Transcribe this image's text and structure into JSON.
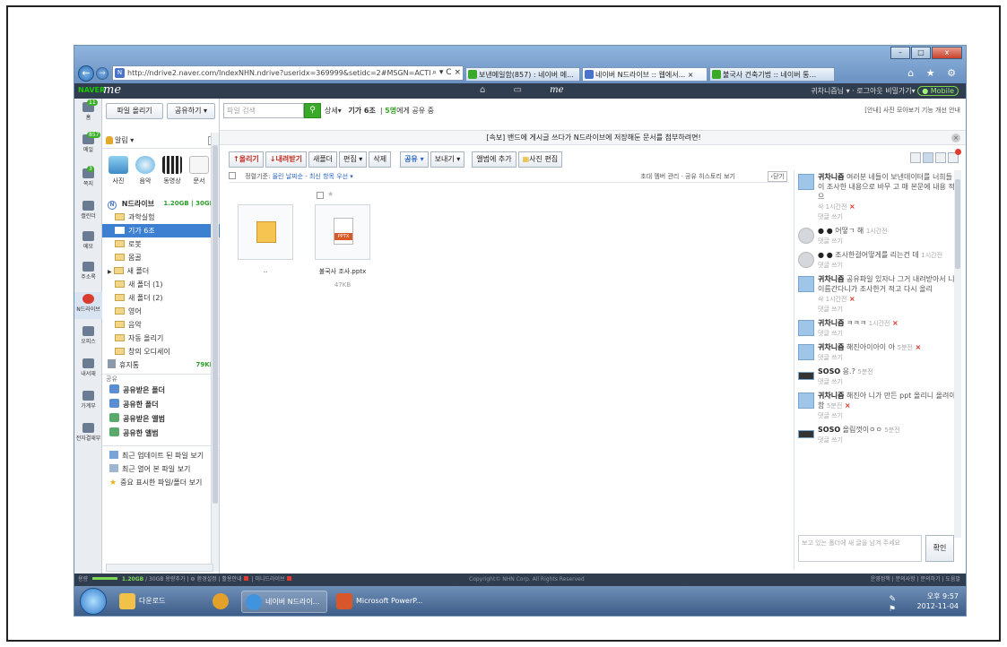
{
  "browser": {
    "url": "http://ndrive2.naver.com/IndexNHN.ndrive?useridx=369999&setidc=2#MSGN=ACTI",
    "url_controls": "⌕ ▾ C ×",
    "tabs": [
      {
        "label": "보낸메일함(857) : 네이버 메...",
        "color": "#3aa828"
      },
      {
        "label": "네이버 N드라이브 :: 웹에서... ×",
        "color": "#4a74c9"
      },
      {
        "label": "불국사 건축기법 :: 네이버 통...",
        "color": "#3aa828"
      }
    ],
    "win_controls": [
      "–",
      "□",
      "x"
    ],
    "right_icons": "⌂ ★ ⚙"
  },
  "naver_bar": {
    "logo": "NAVER",
    "me": "me",
    "center_icons": "⌂ ▭",
    "center_me": "me",
    "right_text": "귀차니즘님 ▾ · 로그아웃 비밀가기▾",
    "mobile": "Mobile"
  },
  "rail": [
    {
      "label": "홈",
      "badge": "11"
    },
    {
      "label": "메일",
      "badge": "857"
    },
    {
      "label": "쪽지",
      "badge": "3"
    },
    {
      "label": "캘린더",
      "badge": ""
    },
    {
      "label": "메모",
      "badge": ""
    },
    {
      "label": "주소록",
      "badge": ""
    },
    {
      "label": "N드라이브",
      "badge": ""
    },
    {
      "label": "오피스",
      "badge": ""
    },
    {
      "label": "내서재",
      "badge": ""
    },
    {
      "label": "가계부",
      "badge": ""
    },
    {
      "label": "전자결재부",
      "badge": ""
    }
  ],
  "sidebar": {
    "upload": "파일 올리기",
    "share": "공유하기 ▾",
    "alarm": "알림 ▾",
    "media": [
      "사진",
      "음악",
      "동영상",
      "문서"
    ],
    "drive_title": "N드라이브",
    "drive_size": "1.20GB | 30GB",
    "folders": [
      "과학실험",
      "기가 6조",
      "로봇",
      "몸골",
      "새 폴더",
      "새 폴더 (1)",
      "새 폴더 (2)",
      "영어",
      "음악",
      "자동 올리기",
      "창의 오디세이"
    ],
    "trash": "휴지통",
    "trash_size": "79KB",
    "share_header": "공유",
    "shared": [
      "공유받은 폴더",
      "공유한 폴더",
      "공유받은 앨범",
      "공유한 앨범"
    ],
    "extras": [
      "최근 업데이트 된 파일 보기",
      "최근 열어 본 파일 보기",
      "중요 표시한 파일/폴더 보기"
    ]
  },
  "main": {
    "search_placeholder": "파일 검색",
    "search_detail": "상세▾",
    "folder_title": "기가 6조",
    "shared_count": "5명",
    "shared_suffix": "에게 공유 중",
    "notice": "[안내] 사진 모아보기 기능 개선 안내",
    "news": "[속보] 밴드에 게시글 쓰다가 N드라이브에 저장해둔 문서를 첨부하려면!",
    "toolbar": [
      "↑올리기",
      "↓내려받기",
      "새폴더",
      "편집 ▾",
      "삭제",
      "공유 ▾",
      "보내기 ▾",
      "앨범에 추가",
      "사진 편집"
    ],
    "sort_label": "정렬기준:",
    "sort_value": "올린 날짜순 - 최신 항목 우선 ▾",
    "sort_links": "초대 멤버 관리 · 공유 히스토리 보기",
    "fold": "‹닫기",
    "files": [
      {
        "name": "..",
        "size": ""
      },
      {
        "name": "불국사 조사.pptx",
        "size": "47KB",
        "type": "PPTX"
      }
    ]
  },
  "comments": [
    {
      "name": "귀차니즘",
      "text": "여러분 네들이 보낸데이터를 너희들이 조사한 내용으로 바무 고 매 본문에 내용 적으",
      "time": "삭 1시간전",
      "x": true,
      "reply": "댓글 쓰기",
      "av": "blue"
    },
    {
      "name": "● ●",
      "text": "어떻ㄱ 해",
      "time": "1시간전",
      "x": false,
      "reply": "댓글 쓰기",
      "av": "gray"
    },
    {
      "name": "● ●",
      "text": "조사한걸어떻게를 리는건 데",
      "time": "1시간전",
      "x": false,
      "reply": "댓글 쓰기",
      "av": "gray"
    },
    {
      "name": "귀차니즘",
      "text": "공유파일 있자나 그거 내려받아서 니 이름간다니가 조사한거 적고 다시 올리",
      "time": "삭 1시간전",
      "x": true,
      "reply": "댓글 쓰기",
      "av": "blue"
    },
    {
      "name": "귀차니즘",
      "text": "ㅋㅋㅋ",
      "time": "1시간전",
      "x": true,
      "reply": "댓글 쓰기",
      "av": "blue"
    },
    {
      "name": "귀차니즘",
      "text": "해진아이아이 아",
      "time": "5분전",
      "x": true,
      "reply": "댓글 쓰기",
      "av": "blue"
    },
    {
      "name": "SOSO",
      "text": "응.?",
      "time": "5분전",
      "x": false,
      "reply": "댓글 쓰기",
      "av": "soso"
    },
    {
      "name": "귀차니즘",
      "text": "해진아 니가 만든 ppt 올리니 올려야함",
      "time": "5분전",
      "x": true,
      "reply": "댓글 쓰기",
      "av": "blue"
    },
    {
      "name": "SOSO",
      "text": "올림껏이ㅇㅇ",
      "time": "5분전",
      "x": false,
      "reply": "댓글 쓰기",
      "av": "soso"
    }
  ],
  "comment_input_placeholder": "보고 있는 폴더에 새 글을 남겨 주세요",
  "comment_submit": "확인",
  "footer": {
    "usage_label": "용량",
    "usage": "1.20GB",
    "usage_total": "/ 30GB",
    "links_left": "용량추가 | ⚙ 환경설정 | 활용안내",
    "link_mini": "| 미니드라이브",
    "copyright": "Copyright© NHN Corp. All Rights Reserved",
    "links_right": "운영정책 | 문의사항 | 문의하기 | 도움말"
  },
  "taskbar": {
    "tasks": [
      {
        "label": "다운로드",
        "color": "#f2c14a"
      },
      {
        "label": "",
        "color": "#e2a12a"
      },
      {
        "label": "네이버 N드라이...",
        "color": "#3f94dd"
      },
      {
        "label": "Microsoft PowerP...",
        "color": "#d8572a"
      }
    ],
    "tray_icons": "✎ ⚑ ◀ ▣",
    "time": "오후 9:57",
    "date": "2012-11-04"
  }
}
